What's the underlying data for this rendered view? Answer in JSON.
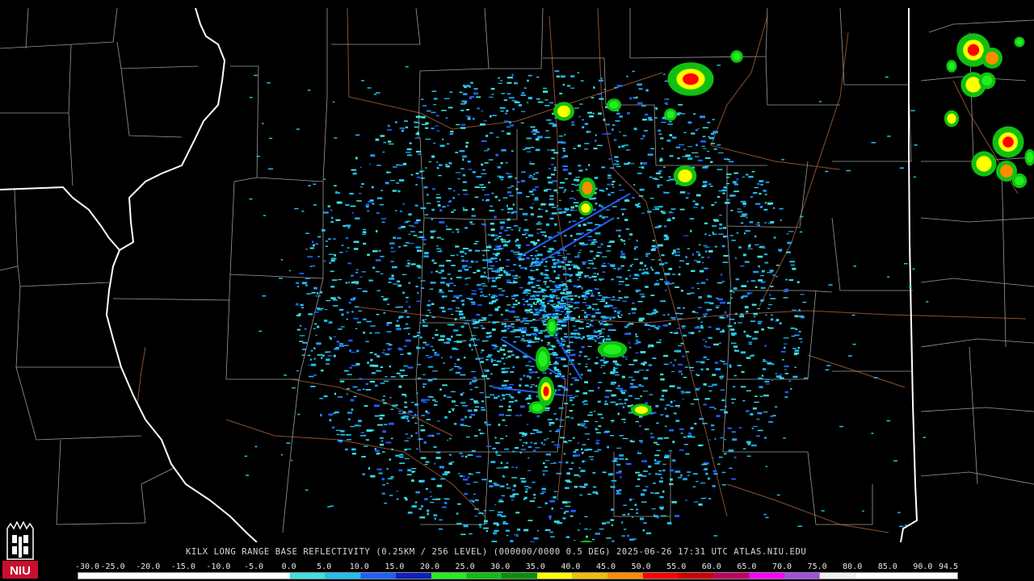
{
  "product_caption": "KILX LONG RANGE BASE REFLECTIVITY (0.25KM / 256 LEVEL) (000000/0000 0.5 DEG) 2025-06-26 17:31 UTC  ATLAS.NIU.EDU",
  "logo_text": "NIU",
  "colors": {
    "background": "#000000",
    "state_border": "#ffffff",
    "county_border": "#9a9a9a",
    "highway": "#8a5030"
  },
  "color_scale": {
    "labels": [
      "-30.0",
      "-25.0",
      "-20.0",
      "-15.0",
      "-10.0",
      "-5.0",
      "0.0",
      "5.0",
      "10.0",
      "15.0",
      "20.0",
      "25.0",
      "30.0",
      "35.0",
      "40.0",
      "45.0",
      "50.0",
      "55.0",
      "60.0",
      "65.0",
      "70.0",
      "75.0",
      "80.0",
      "85.0",
      "90.0",
      "94.5"
    ],
    "segments": [
      {
        "from": -30,
        "to": 0,
        "color": "#ffffff"
      },
      {
        "from": 0,
        "to": 5,
        "color": "#40e0e0"
      },
      {
        "from": 5,
        "to": 10,
        "color": "#20c0f0"
      },
      {
        "from": 10,
        "to": 15,
        "color": "#1e60ff"
      },
      {
        "from": 15,
        "to": 20,
        "color": "#1020c0"
      },
      {
        "from": 20,
        "to": 25,
        "color": "#20f020"
      },
      {
        "from": 25,
        "to": 30,
        "color": "#10c010"
      },
      {
        "from": 30,
        "to": 35,
        "color": "#089008"
      },
      {
        "from": 35,
        "to": 40,
        "color": "#ffff00"
      },
      {
        "from": 40,
        "to": 45,
        "color": "#f0c000"
      },
      {
        "from": 45,
        "to": 50,
        "color": "#ff8c00"
      },
      {
        "from": 50,
        "to": 55,
        "color": "#ff0000"
      },
      {
        "from": 55,
        "to": 60,
        "color": "#d00000"
      },
      {
        "from": 60,
        "to": 65,
        "color": "#c00060"
      },
      {
        "from": 65,
        "to": 70,
        "color": "#ff00ff"
      },
      {
        "from": 70,
        "to": 75,
        "color": "#a050e0"
      },
      {
        "from": 75,
        "to": 80,
        "color": "#f0f0f0"
      },
      {
        "from": 80,
        "to": 94.5,
        "color": "#ffffff"
      }
    ]
  }
}
